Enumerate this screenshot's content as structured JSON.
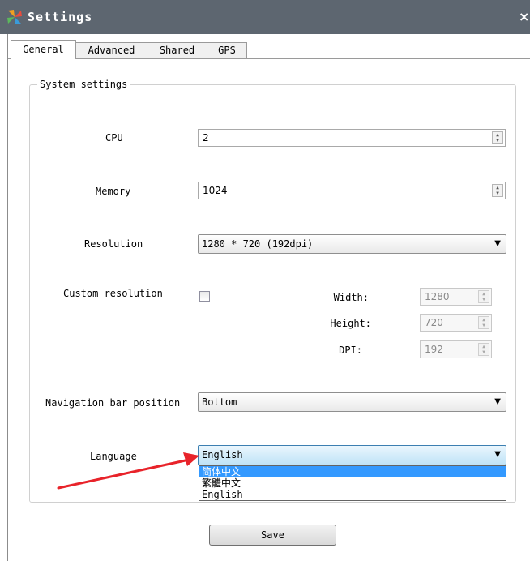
{
  "window": {
    "title": "Settings",
    "close_glyph": "×",
    "app_icon": "app-pinwheel-icon"
  },
  "tabs": [
    {
      "label": "General",
      "active": true
    },
    {
      "label": "Advanced",
      "active": false
    },
    {
      "label": "Shared",
      "active": false
    },
    {
      "label": "GPS",
      "active": false
    }
  ],
  "system_settings": {
    "legend": "System settings",
    "cpu": {
      "label": "CPU",
      "value": "2"
    },
    "memory": {
      "label": "Memory",
      "value": "1024"
    },
    "resolution": {
      "label": "Resolution",
      "value": "1280 * 720 (192dpi)"
    },
    "custom_resolution": {
      "label": "Custom resolution",
      "checked": false,
      "width": {
        "label": "Width:",
        "value": "1280"
      },
      "height": {
        "label": "Height:",
        "value": "720"
      },
      "dpi": {
        "label": "DPI:",
        "value": "192"
      }
    },
    "navigation_bar": {
      "label": "Navigation bar position",
      "value": "Bottom"
    },
    "language": {
      "label": "Language",
      "value": "English",
      "options": [
        "简体中文",
        "繁體中文",
        "English"
      ],
      "highlighted_option": "简体中文"
    }
  },
  "buttons": {
    "save": "Save"
  },
  "colors": {
    "titlebar": "#5d6670",
    "selection": "#3399ff",
    "annotation_arrow": "#e8232a"
  }
}
